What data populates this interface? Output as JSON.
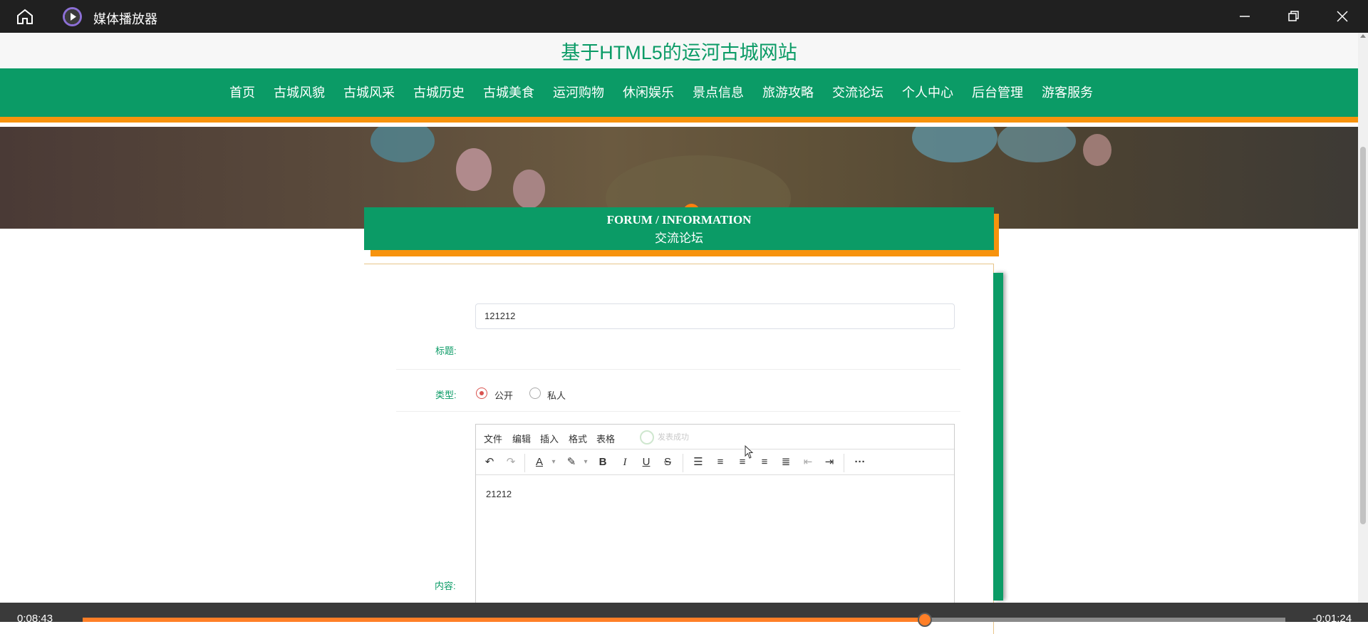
{
  "player": {
    "app_title": "媒体播放器",
    "time_elapsed": "0:08:43",
    "time_remaining": "-0:01:24",
    "progress_fraction": 0.7
  },
  "site": {
    "title": "基于HTML5的运河古城网站",
    "nav": [
      "首页",
      "古城风貌",
      "古城风采",
      "古城历史",
      "古城美食",
      "运河购物",
      "休闲娱乐",
      "景点信息",
      "旅游攻略",
      "交流论坛",
      "个人中心",
      "后台管理",
      "游客服务"
    ]
  },
  "forum": {
    "heading_en": "FORUM / INFORMATION",
    "heading_cn": "交流论坛"
  },
  "form": {
    "title_label": "标题:",
    "title_value": "121212",
    "type_label": "类型:",
    "type_options": [
      "公开",
      "私人"
    ],
    "type_selected": "公开",
    "content_label": "内容:"
  },
  "editor": {
    "menus": [
      "文件",
      "编辑",
      "插入",
      "格式",
      "表格"
    ],
    "toast": "发表成功",
    "body_text": "21212"
  },
  "colors": {
    "brand_green": "#0b9b66",
    "accent_orange": "#f7930d"
  }
}
